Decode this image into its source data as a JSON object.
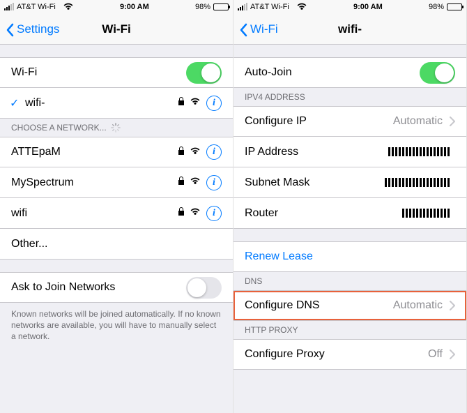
{
  "left": {
    "status": {
      "carrier": "AT&T Wi-Fi",
      "time": "9:00 AM",
      "battery": "98%"
    },
    "nav": {
      "back": "Settings",
      "title": "Wi-Fi"
    },
    "wifi_toggle": {
      "label": "Wi-Fi",
      "on": true
    },
    "connected": {
      "name": "wifi-"
    },
    "choose_header": "CHOOSE A NETWORK...",
    "networks": [
      {
        "name": "ATTEpaM"
      },
      {
        "name": "MySpectrum"
      },
      {
        "name": "wifi"
      }
    ],
    "other_label": "Other...",
    "ask": {
      "label": "Ask to Join Networks",
      "on": false
    },
    "ask_footer": "Known networks will be joined automatically. If no known networks are available, you will have to manually select a network."
  },
  "right": {
    "status": {
      "carrier": "AT&T Wi-Fi",
      "time": "9:00 AM",
      "battery": "98%"
    },
    "nav": {
      "back": "Wi-Fi",
      "title": "wifi-"
    },
    "auto_join": {
      "label": "Auto-Join",
      "on": true
    },
    "ipv4_header": "IPV4 ADDRESS",
    "configure_ip": {
      "label": "Configure IP",
      "value": "Automatic"
    },
    "ip_address": {
      "label": "IP Address",
      "value": "███.███.█.██"
    },
    "subnet": {
      "label": "Subnet Mask",
      "value": "███.███.███.█"
    },
    "router": {
      "label": "Router",
      "value": "███.██.██"
    },
    "renew": "Renew Lease",
    "dns_header": "DNS",
    "configure_dns": {
      "label": "Configure DNS",
      "value": "Automatic"
    },
    "proxy_header": "HTTP PROXY",
    "configure_proxy": {
      "label": "Configure Proxy",
      "value": "Off"
    }
  }
}
